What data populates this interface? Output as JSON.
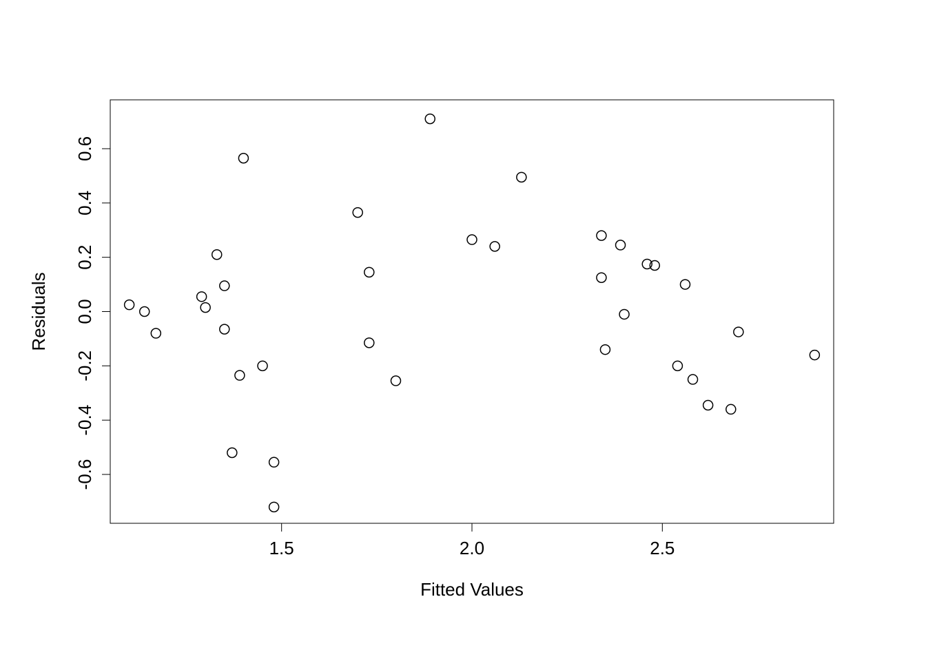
{
  "chart_data": {
    "type": "scatter",
    "xlabel": "Fitted Values",
    "ylabel": "Residuals",
    "title": "",
    "xlim": [
      1.05,
      2.95
    ],
    "ylim": [
      -0.78,
      0.78
    ],
    "x_ticks": [
      1.5,
      2.0,
      2.5
    ],
    "y_ticks": [
      -0.6,
      -0.4,
      -0.2,
      0.0,
      0.2,
      0.4,
      0.6
    ],
    "x_tick_labels": [
      "1.5",
      "2.0",
      "2.5"
    ],
    "y_tick_labels": [
      "-0.6",
      "-0.4",
      "-0.2",
      "0.0",
      "0.2",
      "0.4",
      "0.6"
    ],
    "points": [
      {
        "x": 1.1,
        "y": 0.025
      },
      {
        "x": 1.14,
        "y": 0.0
      },
      {
        "x": 1.17,
        "y": -0.08
      },
      {
        "x": 1.29,
        "y": 0.055
      },
      {
        "x": 1.3,
        "y": 0.015
      },
      {
        "x": 1.33,
        "y": 0.21
      },
      {
        "x": 1.35,
        "y": 0.095
      },
      {
        "x": 1.35,
        "y": -0.065
      },
      {
        "x": 1.37,
        "y": -0.52
      },
      {
        "x": 1.39,
        "y": -0.235
      },
      {
        "x": 1.4,
        "y": 0.565
      },
      {
        "x": 1.45,
        "y": -0.2
      },
      {
        "x": 1.48,
        "y": -0.555
      },
      {
        "x": 1.48,
        "y": -0.72
      },
      {
        "x": 1.7,
        "y": 0.365
      },
      {
        "x": 1.73,
        "y": 0.145
      },
      {
        "x": 1.73,
        "y": -0.115
      },
      {
        "x": 1.8,
        "y": -0.255
      },
      {
        "x": 1.89,
        "y": 0.71
      },
      {
        "x": 2.0,
        "y": 0.265
      },
      {
        "x": 2.06,
        "y": 0.24
      },
      {
        "x": 2.13,
        "y": 0.495
      },
      {
        "x": 2.34,
        "y": 0.28
      },
      {
        "x": 2.34,
        "y": 0.125
      },
      {
        "x": 2.35,
        "y": -0.14
      },
      {
        "x": 2.39,
        "y": 0.245
      },
      {
        "x": 2.4,
        "y": -0.01
      },
      {
        "x": 2.46,
        "y": 0.175
      },
      {
        "x": 2.48,
        "y": 0.17
      },
      {
        "x": 2.54,
        "y": -0.2
      },
      {
        "x": 2.56,
        "y": 0.1
      },
      {
        "x": 2.58,
        "y": -0.25
      },
      {
        "x": 2.62,
        "y": -0.345
      },
      {
        "x": 2.68,
        "y": -0.36
      },
      {
        "x": 2.7,
        "y": -0.075
      },
      {
        "x": 2.9,
        "y": -0.16
      }
    ]
  }
}
